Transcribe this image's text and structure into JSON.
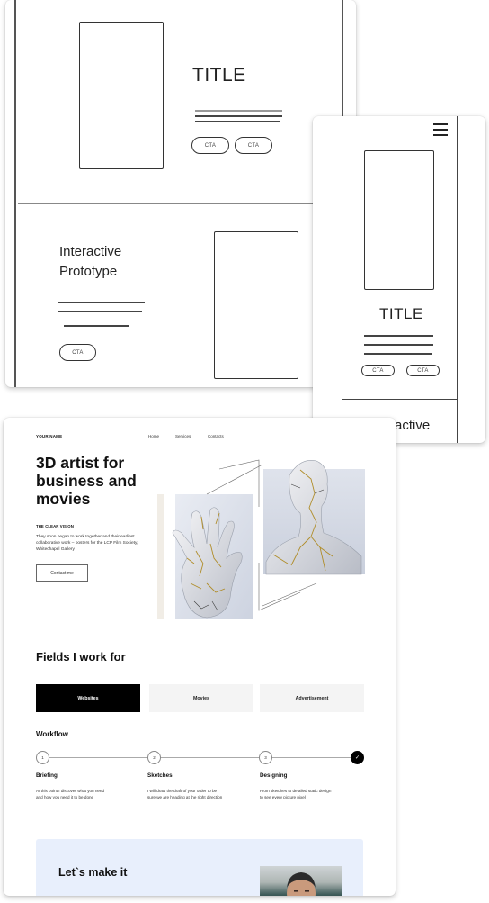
{
  "wireframe_desktop": {
    "hero": {
      "title": "TITLE",
      "cta_buttons": [
        "CTA",
        "CTA"
      ]
    },
    "section2": {
      "heading_line1": "Interactive",
      "heading_line2": "Prototype",
      "cta_button": "CTA"
    }
  },
  "wireframe_mobile": {
    "menu_icon": "hamburger-icon",
    "hero": {
      "title": "TITLE",
      "cta_buttons": [
        "CTA",
        "CTA"
      ]
    },
    "section2": {
      "heading_line1": "Interactive"
    }
  },
  "website": {
    "header": {
      "logo": "YOUR NAME",
      "nav": [
        "Home",
        "Services",
        "Contacts"
      ]
    },
    "hero": {
      "title": "3D artist for business and movies",
      "eyebrow": "THE CLEAR VISION",
      "description": "They soon began to work together and their earliest collaborative work – posters for the LCP Film Society, Whitechapel Gallery",
      "contact_button": "Contact me",
      "images": [
        "cracked-marble-hand-image",
        "cracked-marble-bust-image"
      ]
    },
    "fields": {
      "title": "Fields I work for",
      "tabs": [
        {
          "label": "Websites",
          "active": true
        },
        {
          "label": "Movies",
          "active": false
        },
        {
          "label": "Advertisement",
          "active": false
        }
      ]
    },
    "workflow": {
      "title": "Workflow",
      "steps": [
        {
          "number": "1",
          "title": "Briefing",
          "description": "At this point I discover what you need and how you need it to be done"
        },
        {
          "number": "2",
          "title": "Sketches",
          "description": "I will draw the draft of your order to be sure we are heading at the right direction"
        },
        {
          "number": "3",
          "title": "Designing",
          "description": "From sketches to detailed static design to see every picture pixel"
        },
        {
          "number": "✓",
          "title": "",
          "description": ""
        }
      ]
    },
    "cta_banner": {
      "title": "Let`s make it",
      "background": "#e8effc"
    }
  },
  "colors": {
    "active_tab": "#000000",
    "inactive_tab": "#f4f4f4",
    "banner": "#e8effc"
  }
}
